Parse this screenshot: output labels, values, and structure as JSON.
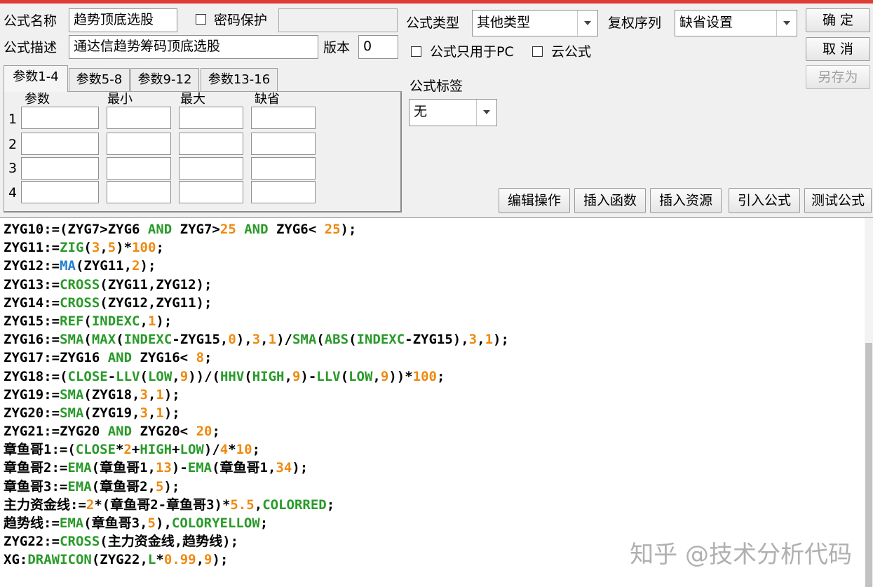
{
  "window": {
    "accent": "#e03b32"
  },
  "form": {
    "name_label": "公式名称",
    "name_value": "趋势顶底选股",
    "password_label": "密码保护",
    "password_value": "",
    "desc_label": "公式描述",
    "desc_value": "通达信趋势筹码顶底选股",
    "version_label": "版本",
    "version_value": "0",
    "type_label": "公式类型",
    "type_value": "其他类型",
    "rights_label": "复权序列",
    "rights_value": "缺省设置",
    "pc_only_label": "公式只用于PC",
    "cloud_label": "云公式",
    "tag_label": "公式标签",
    "tag_value": "无"
  },
  "buttons": {
    "ok": "确 定",
    "cancel": "取 消",
    "save_as": "另存为",
    "edit_ops": "编辑操作",
    "insert_func": "插入函数",
    "insert_res": "插入资源",
    "import_formula": "引入公式",
    "test_formula": "测试公式"
  },
  "tabs": [
    "参数1-4",
    "参数5-8",
    "参数9-12",
    "参数13-16"
  ],
  "params": {
    "headers": [
      "参数",
      "最小",
      "最大",
      "缺省"
    ],
    "rows": [
      "1",
      "2",
      "3",
      "4"
    ]
  },
  "code_lines": [
    [
      [
        "p",
        "ZYG10:=(ZYG7>ZYG6 "
      ],
      [
        "k",
        "AND"
      ],
      [
        "p",
        " ZYG7>"
      ],
      [
        "n",
        "25"
      ],
      [
        "p",
        " "
      ],
      [
        "k",
        "AND"
      ],
      [
        "p",
        " ZYG6< "
      ],
      [
        "n",
        "25"
      ],
      [
        "p",
        ");"
      ]
    ],
    [
      [
        "p",
        "ZYG11:="
      ],
      [
        "f",
        "ZIG"
      ],
      [
        "p",
        "("
      ],
      [
        "n",
        "3"
      ],
      [
        "p",
        ","
      ],
      [
        "n",
        "5"
      ],
      [
        "p",
        ")*"
      ],
      [
        "n",
        "100"
      ],
      [
        "p",
        ";"
      ]
    ],
    [
      [
        "p",
        "ZYG12:="
      ],
      [
        "m",
        "MA"
      ],
      [
        "p",
        "(ZYG11,"
      ],
      [
        "n",
        "2"
      ],
      [
        "p",
        ");"
      ]
    ],
    [
      [
        "p",
        "ZYG13:="
      ],
      [
        "f",
        "CROSS"
      ],
      [
        "p",
        "(ZYG11,ZYG12);"
      ]
    ],
    [
      [
        "p",
        "ZYG14:="
      ],
      [
        "f",
        "CROSS"
      ],
      [
        "p",
        "(ZYG12,ZYG11);"
      ]
    ],
    [
      [
        "p",
        "ZYG15:="
      ],
      [
        "f",
        "REF"
      ],
      [
        "p",
        "("
      ],
      [
        "f",
        "INDEXC"
      ],
      [
        "p",
        ","
      ],
      [
        "n",
        "1"
      ],
      [
        "p",
        ");"
      ]
    ],
    [
      [
        "p",
        "ZYG16:="
      ],
      [
        "f",
        "SMA"
      ],
      [
        "p",
        "("
      ],
      [
        "f",
        "MAX"
      ],
      [
        "p",
        "("
      ],
      [
        "f",
        "INDEXC"
      ],
      [
        "p",
        "-ZYG15,"
      ],
      [
        "n",
        "0"
      ],
      [
        "p",
        "),"
      ],
      [
        "n",
        "3"
      ],
      [
        "p",
        ","
      ],
      [
        "n",
        "1"
      ],
      [
        "p",
        ")/"
      ],
      [
        "f",
        "SMA"
      ],
      [
        "p",
        "("
      ],
      [
        "f",
        "ABS"
      ],
      [
        "p",
        "("
      ],
      [
        "f",
        "INDEXC"
      ],
      [
        "p",
        "-ZYG15),"
      ],
      [
        "n",
        "3"
      ],
      [
        "p",
        ","
      ],
      [
        "n",
        "1"
      ],
      [
        "p",
        ");"
      ]
    ],
    [
      [
        "p",
        "ZYG17:=ZYG16 "
      ],
      [
        "k",
        "AND"
      ],
      [
        "p",
        " ZYG16< "
      ],
      [
        "n",
        "8"
      ],
      [
        "p",
        ";"
      ]
    ],
    [
      [
        "p",
        "ZYG18:=("
      ],
      [
        "f",
        "CLOSE"
      ],
      [
        "p",
        "-"
      ],
      [
        "f",
        "LLV"
      ],
      [
        "p",
        "("
      ],
      [
        "f",
        "LOW"
      ],
      [
        "p",
        ","
      ],
      [
        "n",
        "9"
      ],
      [
        "p",
        "))/("
      ],
      [
        "f",
        "HHV"
      ],
      [
        "p",
        "("
      ],
      [
        "f",
        "HIGH"
      ],
      [
        "p",
        ","
      ],
      [
        "n",
        "9"
      ],
      [
        "p",
        ")-"
      ],
      [
        "f",
        "LLV"
      ],
      [
        "p",
        "("
      ],
      [
        "f",
        "LOW"
      ],
      [
        "p",
        ","
      ],
      [
        "n",
        "9"
      ],
      [
        "p",
        "))*"
      ],
      [
        "n",
        "100"
      ],
      [
        "p",
        ";"
      ]
    ],
    [
      [
        "p",
        "ZYG19:="
      ],
      [
        "f",
        "SMA"
      ],
      [
        "p",
        "(ZYG18,"
      ],
      [
        "n",
        "3"
      ],
      [
        "p",
        ","
      ],
      [
        "n",
        "1"
      ],
      [
        "p",
        ");"
      ]
    ],
    [
      [
        "p",
        "ZYG20:="
      ],
      [
        "f",
        "SMA"
      ],
      [
        "p",
        "(ZYG19,"
      ],
      [
        "n",
        "3"
      ],
      [
        "p",
        ","
      ],
      [
        "n",
        "1"
      ],
      [
        "p",
        ");"
      ]
    ],
    [
      [
        "p",
        "ZYG21:=ZYG20 "
      ],
      [
        "k",
        "AND"
      ],
      [
        "p",
        " ZYG20< "
      ],
      [
        "n",
        "20"
      ],
      [
        "p",
        ";"
      ]
    ],
    [
      [
        "p",
        "章鱼哥1:=("
      ],
      [
        "f",
        "CLOSE"
      ],
      [
        "p",
        "*"
      ],
      [
        "n",
        "2"
      ],
      [
        "p",
        "+"
      ],
      [
        "f",
        "HIGH"
      ],
      [
        "p",
        "+"
      ],
      [
        "f",
        "LOW"
      ],
      [
        "p",
        ")/"
      ],
      [
        "n",
        "4"
      ],
      [
        "p",
        "*"
      ],
      [
        "n",
        "10"
      ],
      [
        "p",
        ";"
      ]
    ],
    [
      [
        "p",
        "章鱼哥2:="
      ],
      [
        "f",
        "EMA"
      ],
      [
        "p",
        "(章鱼哥1,"
      ],
      [
        "n",
        "13"
      ],
      [
        "p",
        ")-"
      ],
      [
        "f",
        "EMA"
      ],
      [
        "p",
        "(章鱼哥1,"
      ],
      [
        "n",
        "34"
      ],
      [
        "p",
        ");"
      ]
    ],
    [
      [
        "p",
        "章鱼哥3:="
      ],
      [
        "f",
        "EMA"
      ],
      [
        "p",
        "(章鱼哥2,"
      ],
      [
        "n",
        "5"
      ],
      [
        "p",
        ");"
      ]
    ],
    [
      [
        "p",
        "主力资金线:="
      ],
      [
        "n",
        "2"
      ],
      [
        "p",
        "*(章鱼哥2-章鱼哥3)*"
      ],
      [
        "n",
        "5.5"
      ],
      [
        "p",
        ","
      ],
      [
        "f",
        "COLORRED"
      ],
      [
        "p",
        ";"
      ]
    ],
    [
      [
        "p",
        "趋势线:="
      ],
      [
        "f",
        "EMA"
      ],
      [
        "p",
        "(章鱼哥3,"
      ],
      [
        "n",
        "5"
      ],
      [
        "p",
        "),"
      ],
      [
        "f",
        "COLORYELLOW"
      ],
      [
        "p",
        ";"
      ]
    ],
    [
      [
        "p",
        "ZYG22:="
      ],
      [
        "f",
        "CROSS"
      ],
      [
        "p",
        "(主力资金线,趋势线);"
      ]
    ],
    [
      [
        "p",
        "XG:"
      ],
      [
        "f",
        "DRAWICON"
      ],
      [
        "p",
        "(ZYG22,"
      ],
      [
        "f",
        "L"
      ],
      [
        "p",
        "*"
      ],
      [
        "n",
        "0.99"
      ],
      [
        "p",
        ","
      ],
      [
        "n",
        "9"
      ],
      [
        "p",
        ");"
      ]
    ]
  ],
  "watermark": "知乎 @技术分析代码",
  "colors": {
    "function": "#2a9a2a",
    "number": "#ee8a10",
    "ma": "#2080d0"
  }
}
